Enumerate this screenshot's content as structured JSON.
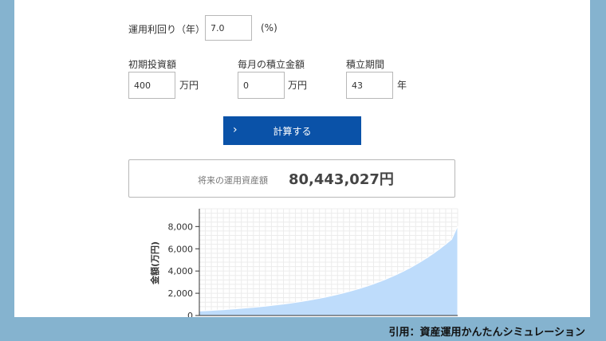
{
  "form": {
    "rate_label": "運用利回り（年）",
    "rate_value": "7.0",
    "rate_unit": "(%)",
    "initial_label": "初期投資額",
    "initial_value": "400",
    "initial_unit": "万円",
    "monthly_label": "毎月の積立金額",
    "monthly_value": "0",
    "monthly_unit": "万円",
    "period_label": "積立期間",
    "period_value": "43",
    "period_unit": "年"
  },
  "calculate": {
    "chevron": "›",
    "label": "計算する"
  },
  "result": {
    "label": "将来の運用資産額",
    "value": "80,443,027円"
  },
  "credit": "引用：資産運用かんたんシミュレーション",
  "colors": {
    "button": "#0a52a8",
    "area_fill": "#bedcfb",
    "area_stroke": "#ffffff",
    "frame": "#85b3cf"
  },
  "chart_data": {
    "type": "area",
    "ylabel": "金額(万円)",
    "yticks": [
      0,
      2000,
      4000,
      6000,
      8000
    ],
    "ytick_labels": [
      "0",
      "2,000",
      "4,000",
      "6,000",
      "8,000"
    ],
    "ylim": [
      0,
      9600
    ],
    "grid": true,
    "x": [
      0,
      1,
      2,
      3,
      4,
      5,
      6,
      7,
      8,
      9,
      10,
      11,
      12,
      13,
      14,
      15,
      16,
      17,
      18,
      19,
      20,
      21,
      22,
      23,
      24,
      25,
      26,
      27,
      28,
      29,
      30,
      31,
      32,
      33,
      34,
      35,
      36,
      37,
      38,
      39,
      40,
      41,
      42,
      43
    ],
    "values": [
      400,
      428,
      458,
      490,
      524,
      561,
      600,
      642,
      687,
      735,
      787,
      842,
      901,
      964,
      1031,
      1104,
      1181,
      1264,
      1352,
      1447,
      1548,
      1656,
      1772,
      1896,
      2029,
      2171,
      2323,
      2486,
      2660,
      2846,
      3045,
      3258,
      3486,
      3730,
      3991,
      4271,
      4570,
      4890,
      5232,
      5598,
      5990,
      6409,
      6858,
      8044
    ]
  }
}
